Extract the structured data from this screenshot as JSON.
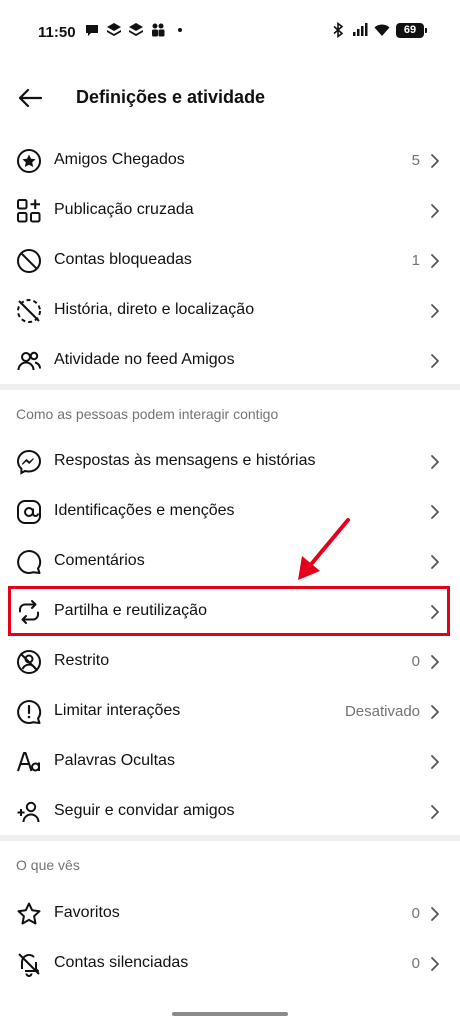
{
  "status_bar": {
    "time": "11:50",
    "battery": "69"
  },
  "header": {
    "title": "Definições e atividade"
  },
  "section1": {
    "items": [
      {
        "label": "Amigos Chegados",
        "value": "5",
        "icon": "star-circle-icon"
      },
      {
        "label": "Publicação cruzada",
        "value": "",
        "icon": "grid-add-icon"
      },
      {
        "label": "Contas bloqueadas",
        "value": "1",
        "icon": "block-icon"
      },
      {
        "label": "História, direto e localização",
        "value": "",
        "icon": "story-off-icon"
      },
      {
        "label": "Atividade no feed Amigos",
        "value": "",
        "icon": "friends-icon"
      }
    ]
  },
  "section2": {
    "header": "Como as pessoas podem interagir contigo",
    "items": [
      {
        "label": "Respostas às mensagens e histórias",
        "value": "",
        "icon": "messenger-icon"
      },
      {
        "label": "Identificações e menções",
        "value": "",
        "icon": "at-icon"
      },
      {
        "label": "Comentários",
        "value": "",
        "icon": "comment-icon"
      },
      {
        "label": "Partilha e reutilização",
        "value": "",
        "icon": "repost-icon"
      },
      {
        "label": "Restrito",
        "value": "0",
        "icon": "restrict-icon"
      },
      {
        "label": "Limitar interações",
        "value": "Desativado",
        "icon": "limit-icon"
      },
      {
        "label": "Palavras Ocultas",
        "value": "",
        "icon": "text-aa-icon"
      },
      {
        "label": "Seguir e convidar amigos",
        "value": "",
        "icon": "add-person-icon"
      }
    ]
  },
  "section3": {
    "header": "O que vês",
    "items": [
      {
        "label": "Favoritos",
        "value": "0",
        "icon": "star-icon"
      },
      {
        "label": "Contas silenciadas",
        "value": "0",
        "icon": "bell-off-icon"
      }
    ]
  },
  "annotation": {
    "color": "#e3001b"
  }
}
